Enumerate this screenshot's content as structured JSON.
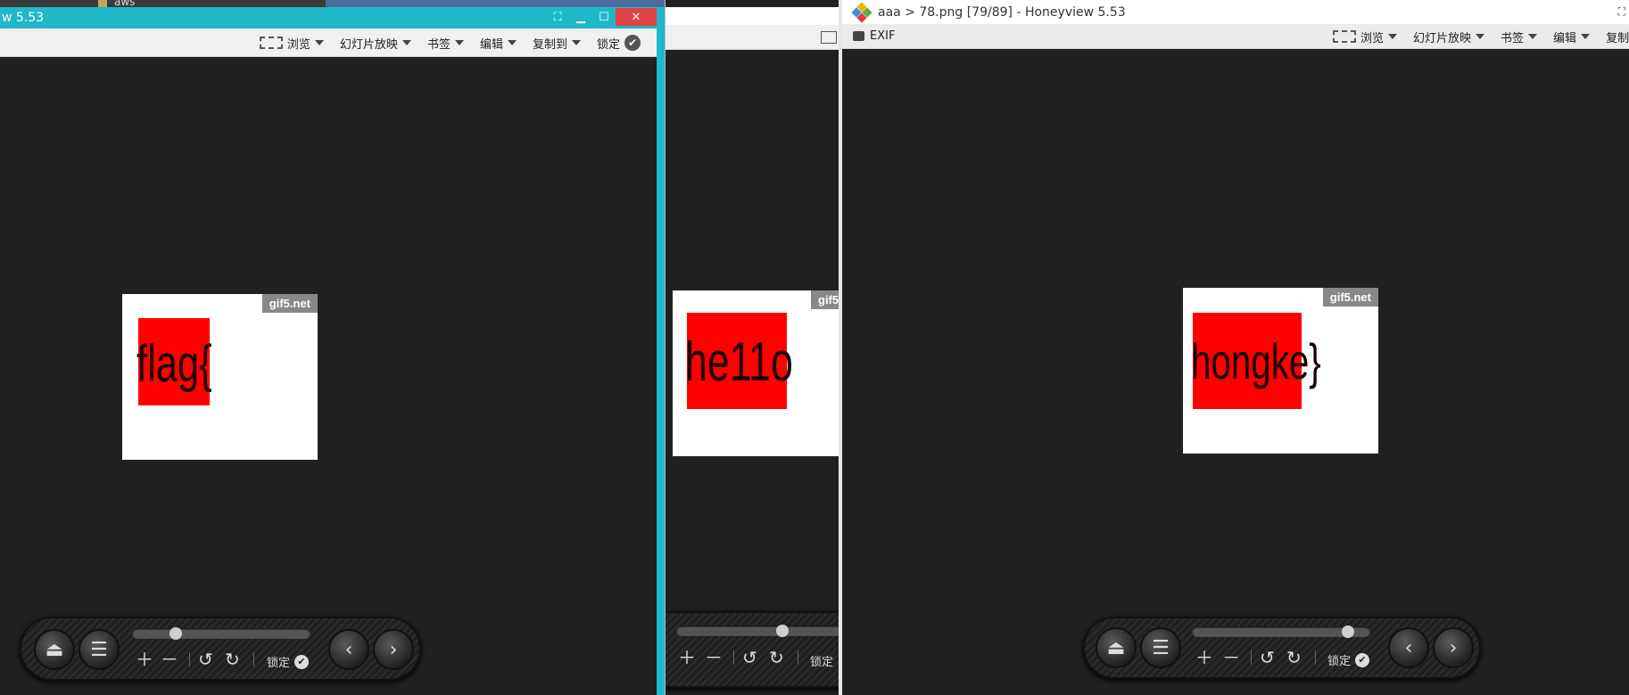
{
  "desktop": {
    "folder_label": "aws"
  },
  "windows": [
    {
      "title": "w 5.53",
      "toolbar": [
        {
          "label": "浏览",
          "icon": "frame-icon"
        },
        {
          "label": "幻灯片放映"
        },
        {
          "label": "书签"
        },
        {
          "label": "编辑"
        },
        {
          "label": "复制到"
        },
        {
          "label": "锁定",
          "icon": "check-icon"
        }
      ],
      "image": {
        "watermark": "gif5.net",
        "text": "flag{"
      },
      "nav": {
        "lock_label": "锁定",
        "slider_position": 0.24
      }
    },
    {
      "title": "",
      "toolbar": [],
      "image": {
        "watermark": "gif5.",
        "text": "he11o"
      },
      "nav": {
        "lock_label": "锁定",
        "slider_position": 0.6
      }
    },
    {
      "title": "aaa > 78.png [79/89] - Honeyview 5.53",
      "exif_label": "EXIF",
      "toolbar": [
        {
          "label": "浏览",
          "icon": "frame-icon"
        },
        {
          "label": "幻灯片放映"
        },
        {
          "label": "书签"
        },
        {
          "label": "编辑"
        },
        {
          "label": "复制到"
        }
      ],
      "image": {
        "watermark": "gif5.net",
        "text": "hongke}"
      },
      "nav": {
        "lock_label": "锁定",
        "slider_position": 0.85
      }
    }
  ],
  "colors": {
    "titlebar_active": "#1fb8c9",
    "titlebar_inactive": "#ffffff",
    "image_red": "#ff0000",
    "canvas": "#202020"
  }
}
